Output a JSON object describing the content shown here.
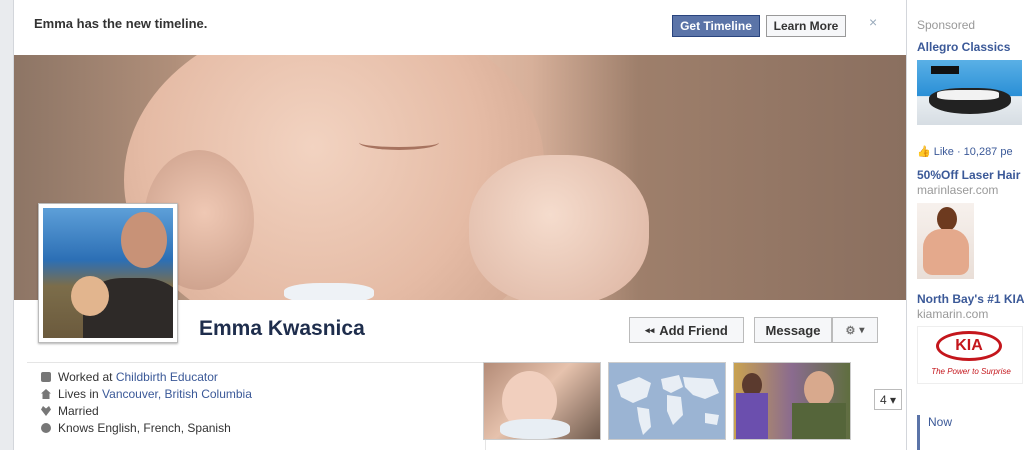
{
  "notice": {
    "text": "Emma has the new timeline.",
    "get_timeline": "Get Timeline",
    "learn_more": "Learn More",
    "close": "×"
  },
  "profile": {
    "name": "Emma Kwasnica",
    "add_friend": "Add Friend",
    "message": "Message",
    "gear_menu": "▾"
  },
  "info": {
    "worked_prefix": "Worked at ",
    "worked_link": "Childbirth Educator",
    "lives_prefix": "Lives in ",
    "lives_link": "Vancouver, British Columbia",
    "married": "Married",
    "knows": "Knows English, French, Spanish"
  },
  "thumbs": {
    "more_count": "4 ▾"
  },
  "sidebar": {
    "title": "Sponsored",
    "ads": [
      {
        "title": "Allegro Classics",
        "like": "Like · 10,287 pe"
      },
      {
        "title": "50%Off Laser Hair",
        "url": "marinlaser.com"
      },
      {
        "title": "North Bay's #1 KIA",
        "url": "kiamarin.com"
      }
    ],
    "kia_logo": "KIA",
    "kia_tagline": "The Power to Surprise",
    "now": "Now"
  },
  "colors": {
    "brand_blue": "#3b5998",
    "button_blue": "#5b74a8"
  }
}
